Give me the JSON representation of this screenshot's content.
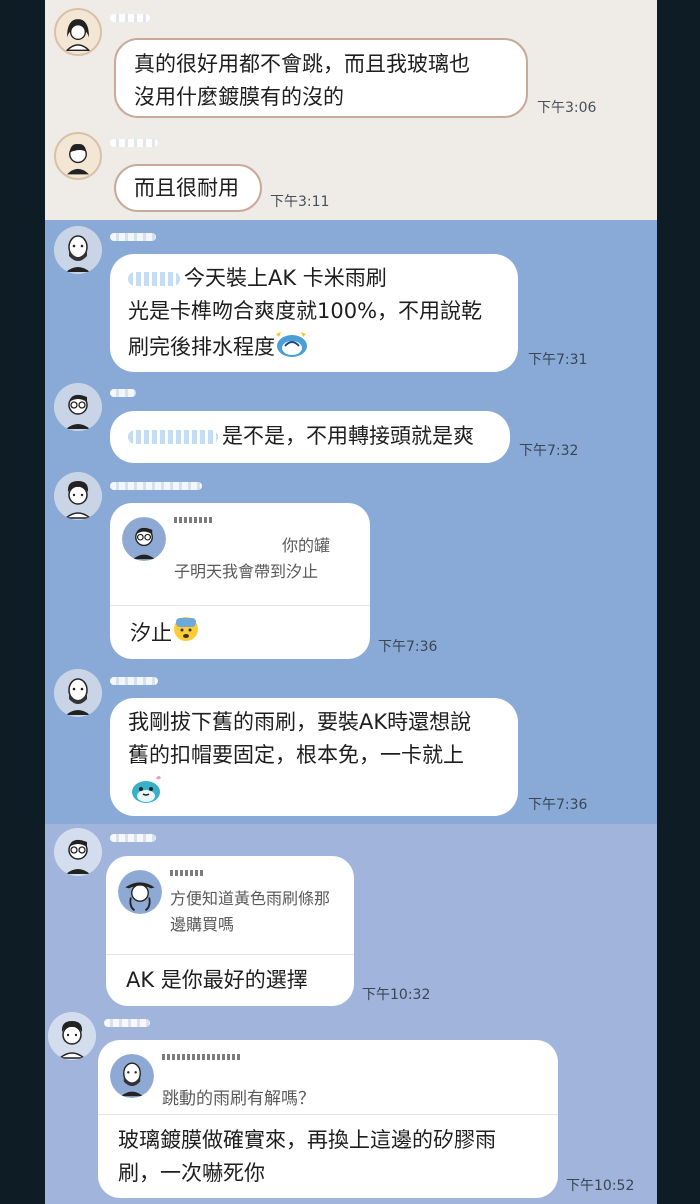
{
  "colors": {
    "beige_bg": "#efebe6",
    "blue_bg": "#89aad6",
    "lavender_bg": "#a0b4dc",
    "side_bg": "#0e1c25",
    "bubble_bg": "#ffffff",
    "beige_border": "#c9a99a"
  },
  "messages": [
    {
      "avatar_icon": "woman-avatar-icon",
      "text": "真的很好用都不會跳，而且我玻璃也\n沒用什麼鍍膜有的沒的",
      "time": "下午3:06"
    },
    {
      "avatar_icon": "man-avatar-icon",
      "text": "而且很耐用",
      "time": "下午3:11"
    },
    {
      "avatar_icon": "bald-bearded-avatar-icon",
      "text_line1": "今天裝上AK 卡米雨刷",
      "text_rest": "光是卡榫吻合爽度就100%，不用說乾\n刷完後排水程度",
      "emoji_icon": "sweat-blob-emoji-icon",
      "time": "下午7:31"
    },
    {
      "avatar_icon": "glasses-man-avatar-icon",
      "text": "是不是，不用轉接頭就是爽",
      "time": "下午7:32"
    },
    {
      "avatar_icon": "curly-hair-avatar-icon",
      "reply_quote": "你的罐\n子明天我會帶到汐止",
      "text": "汐止",
      "emoji_icon": "fearful-face-emoji-icon",
      "time": "下午7:36"
    },
    {
      "avatar_icon": "bald-bearded-avatar-icon",
      "text": "我剛拔下舊的雨刷，要裝AK時還想說\n舊的扣帽要固定，根本免，一卡就上",
      "emoji_icon": "blue-bird-sticker-icon",
      "time": "下午7:36"
    },
    {
      "avatar_icon": "glasses-man-avatar-icon",
      "reply_quote": "方便知道黃色雨刷條那\n邊購買嗎",
      "text": "AK 是你最好的選擇",
      "time": "下午10:32"
    },
    {
      "avatar_icon": "curly-hair-avatar-icon",
      "reply_quote": "跳動的雨刷有解嗎？",
      "text": "玻璃鍍膜做確實來，再換上這邊的矽膠雨\n刷，一次嚇死你",
      "time": "下午10:52"
    }
  ]
}
